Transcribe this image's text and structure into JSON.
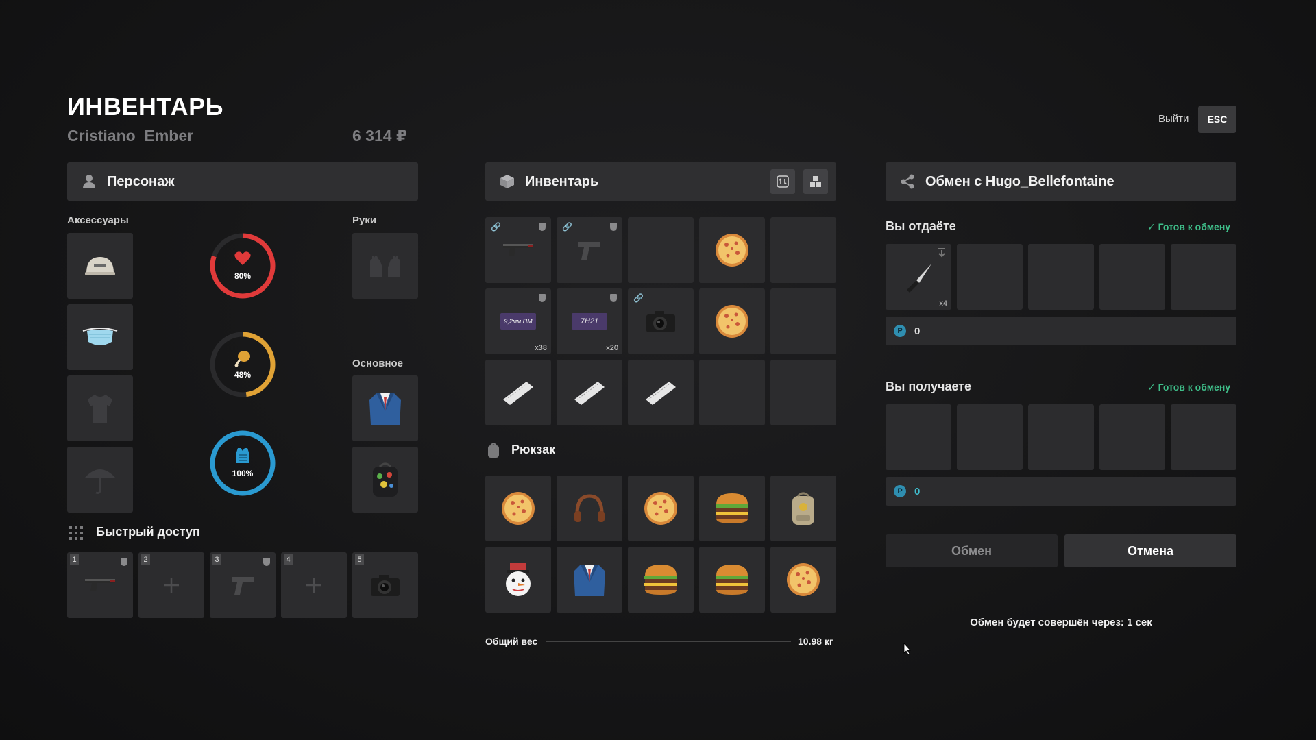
{
  "header": {
    "title": "ИНВЕНТАРЬ",
    "player_name": "Cristiano_Ember",
    "money": "6 314 ₽",
    "exit_label": "Выйти",
    "esc_label": "ESC"
  },
  "character": {
    "panel_title": "Персонаж",
    "accessories_label": "Аксессуары",
    "hands_label": "Руки",
    "main_label": "Основное",
    "accessory_slots": [
      "cap-icon",
      "medical-mask-icon",
      "shirt-placeholder-icon",
      "umbrella-placeholder-icon"
    ],
    "hands_slot": "gloves-placeholder-icon",
    "main_slots": [
      "suit-icon",
      "backpack-icon"
    ],
    "stats": [
      {
        "name": "health",
        "icon": "heart-icon",
        "value": 80,
        "label": "80%",
        "color": "#e03a3a"
      },
      {
        "name": "hunger",
        "icon": "drumstick-icon",
        "value": 48,
        "label": "48%",
        "color": "#e0a235"
      },
      {
        "name": "armor",
        "icon": "armor-vest-icon",
        "value": 100,
        "label": "100%",
        "color": "#2a9ad1"
      }
    ]
  },
  "quick_access": {
    "title": "Быстрый доступ",
    "slots": [
      {
        "number": "1",
        "item": "pistol-icon"
      },
      {
        "number": "2",
        "item": "empty-plus-icon"
      },
      {
        "number": "3",
        "item": "pistol-gray-icon"
      },
      {
        "number": "4",
        "item": "empty-plus-icon"
      },
      {
        "number": "5",
        "item": "camera-icon"
      }
    ]
  },
  "inventory": {
    "panel_title": "Инвентарь",
    "slots": [
      {
        "item": "pistol-icon",
        "qty": ""
      },
      {
        "item": "pistol-gray-icon",
        "qty": ""
      },
      {
        "item": "",
        "qty": ""
      },
      {
        "item": "pizza-icon",
        "qty": ""
      },
      {
        "item": "",
        "qty": ""
      },
      {
        "item": "ammo-9mm-icon",
        "qty": "x38",
        "ammo_label": "9,2мм ПМ"
      },
      {
        "item": "ammo-7h21-icon",
        "qty": "x20",
        "ammo_label": "7Н21"
      },
      {
        "item": "camera-icon",
        "qty": ""
      },
      {
        "item": "pizza-icon",
        "qty": ""
      },
      {
        "item": "",
        "qty": ""
      },
      {
        "item": "ticket-icon",
        "qty": ""
      },
      {
        "item": "ticket-icon",
        "qty": ""
      },
      {
        "item": "ticket-icon",
        "qty": ""
      },
      {
        "item": "",
        "qty": ""
      },
      {
        "item": "",
        "qty": ""
      }
    ],
    "backpack_title": "Рюкзак",
    "backpack_slots": [
      "pizza-icon",
      "headphones-icon",
      "pizza-icon",
      "burger-icon",
      "backpack-tan-icon",
      "snowman-icon",
      "suit-icon",
      "burger-icon",
      "burger-icon",
      "pizza-icon"
    ],
    "weight_label": "Общий вес",
    "weight_value": "10.98 кг"
  },
  "trade": {
    "panel_title": "Обмен с Hugo_Bellefontaine",
    "give_title": "Вы отдаёте",
    "receive_title": "Вы получаете",
    "ready_label": "Готов к обмену",
    "give_slots": [
      {
        "item": "knife-icon",
        "qty": "x4"
      },
      {
        "item": "",
        "qty": ""
      },
      {
        "item": "",
        "qty": ""
      },
      {
        "item": "",
        "qty": ""
      },
      {
        "item": "",
        "qty": ""
      }
    ],
    "give_money": "0",
    "receive_money": "0",
    "currency_symbol": "Р",
    "exchange_button": "Обмен",
    "cancel_button": "Отмена",
    "countdown_text": "Обмен будет совершён через: 1 сек"
  }
}
